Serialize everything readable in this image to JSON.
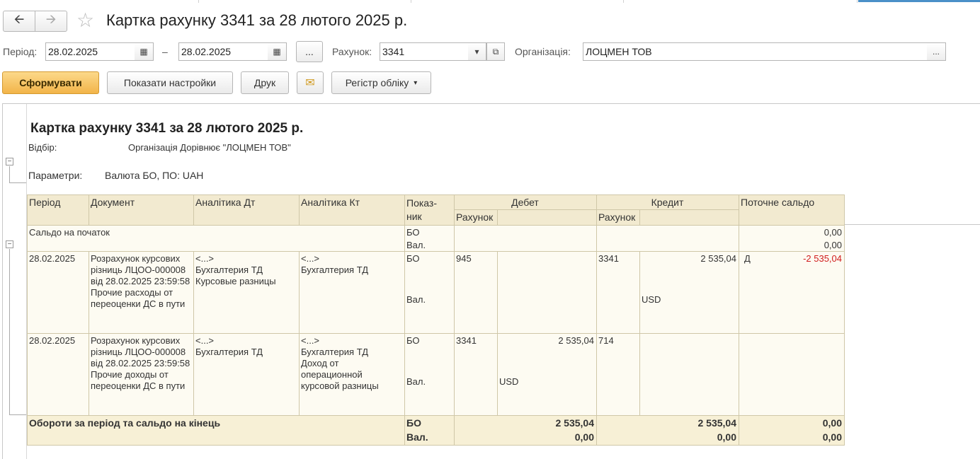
{
  "window": {
    "title": "Картка рахунку 3341 за 28 лютого 2025 р."
  },
  "filters": {
    "period_label": "Період:",
    "date_from": "28.02.2025",
    "date_sep": "–",
    "date_to": "28.02.2025",
    "period_more": "...",
    "account_label": "Рахунок:",
    "account_value": "3341",
    "org_label": "Організація:",
    "org_value": "ЛОЦМЕН ТОВ",
    "org_more": "..."
  },
  "toolbar": {
    "generate": "Сформувати",
    "show_settings": "Показати настройки",
    "print": "Друк",
    "register": "Регістр обліку"
  },
  "report": {
    "title": "Картка рахунку 3341 за 28 лютого 2025 р.",
    "filter_label": "Відбір:",
    "filter_value": "Організація Дорівнює \"ЛОЦМЕН ТОВ\"",
    "params_label": "Параметри:",
    "params_value": "Валюта БО, ПО: UAH",
    "columns": {
      "period": "Період",
      "document": "Документ",
      "analytics_dt": "Аналітика Дт",
      "analytics_kt": "Аналітика Кт",
      "indicator": "Показ-ник",
      "debit": "Дебет",
      "credit": "Кредит",
      "balance": "Поточне сальдо",
      "debit_account": "Рахунок",
      "credit_account": "Рахунок"
    },
    "opening": {
      "label": "Сальдо на початок",
      "ind_bo": "БО",
      "ind_val": "Вал.",
      "bal_bo": "0,00",
      "bal_val": "0,00"
    },
    "rows": [
      {
        "period": "28.02.2025",
        "document": "Розрахунок курсових різниць ЛЦОО-000008 від 28.02.2025 23:59:58 Прочие расходы от переоценки ДС в пути",
        "analytics_dt": "<...>\nБухгалтерия ТД\nКурсовые разницы",
        "analytics_kt": "<...>\nБухгалтерия ТД",
        "ind_bo": "БО",
        "ind_val": "Вал.",
        "debit_account": "945",
        "debit_amount": "",
        "debit_currency": "",
        "credit_account": "3341",
        "credit_amount": "2 535,04",
        "credit_currency": "USD",
        "balance_side": "Д",
        "balance_amount": "-2 535,04"
      },
      {
        "period": "28.02.2025",
        "document": "Розрахунок курсових різниць ЛЦОО-000008 від 28.02.2025 23:59:58 Прочие доходы от переоценки ДС в пути",
        "analytics_dt": "<...>\nБухгалтерия ТД",
        "analytics_kt": "<...>\nБухгалтерия ТД\nДоход от операционной курсовой разницы",
        "ind_bo": "БО",
        "ind_val": "Вал.",
        "debit_account": "3341",
        "debit_amount": "2 535,04",
        "debit_currency": "USD",
        "credit_account": "714",
        "credit_amount": "",
        "credit_currency": "",
        "balance_side": "",
        "balance_amount": ""
      }
    ],
    "totals": {
      "label": "Обороти за період та сальдо на кінець",
      "ind_bo": "БО",
      "ind_val": "Вал.",
      "debit_bo": "2 535,04",
      "debit_val": "0,00",
      "credit_bo": "2 535,04",
      "credit_val": "0,00",
      "balance_bo": "0,00",
      "balance_val": "0,00"
    }
  },
  "colors": {
    "primary_button": "#f2b449",
    "header_bg": "#f2ead0",
    "negative": "#d01c1c"
  }
}
